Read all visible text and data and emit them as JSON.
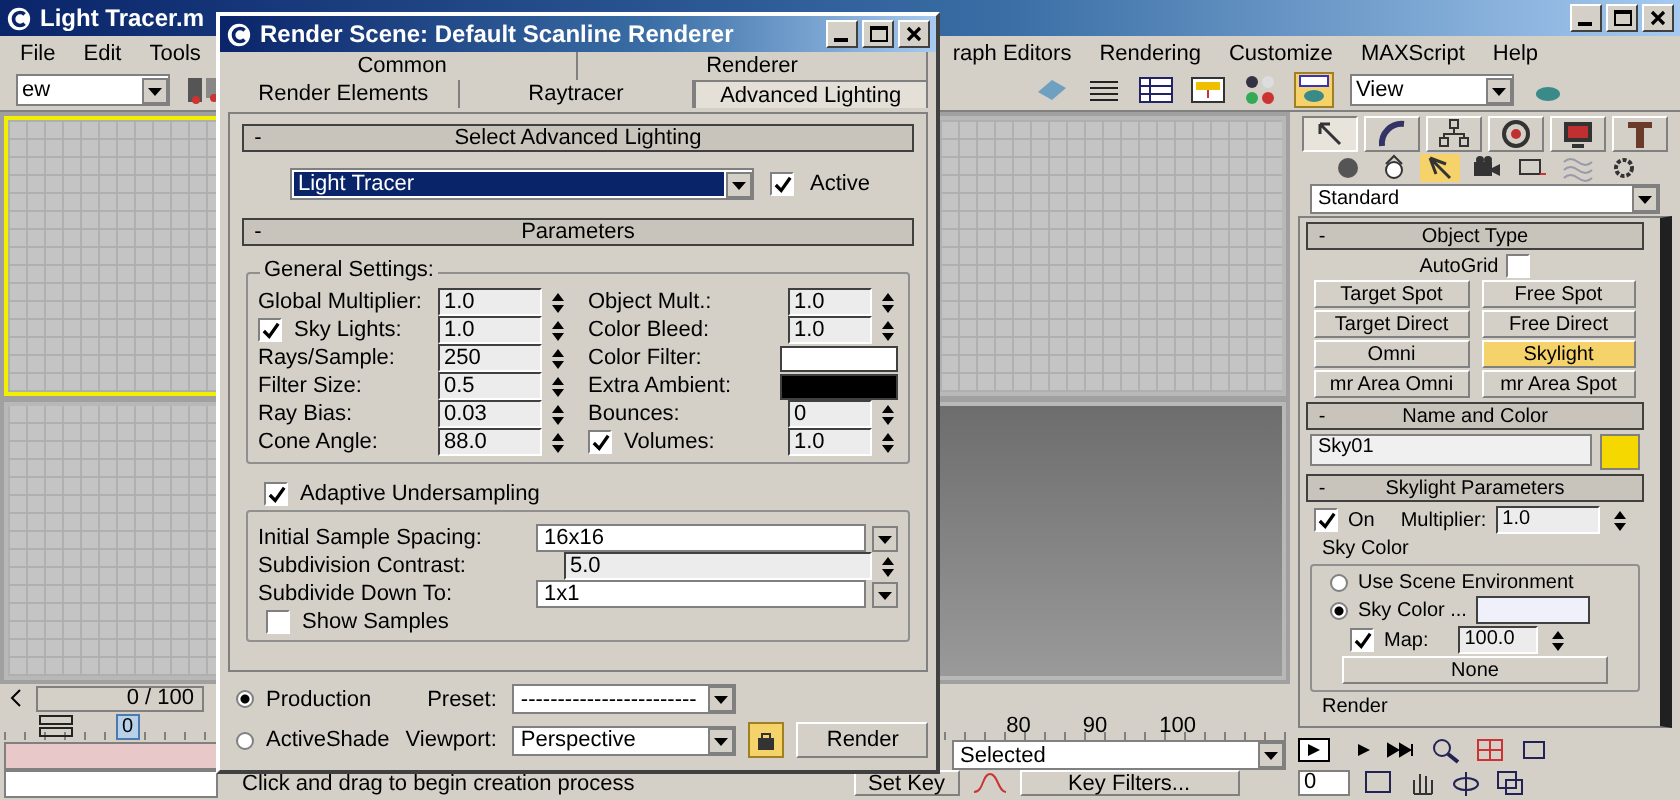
{
  "app": {
    "title": "Light Tracer.m",
    "menu": [
      "File",
      "Edit",
      "Tools",
      "raph Editors",
      "Rendering",
      "Customize",
      "MAXScript",
      "Help"
    ],
    "left_dropdown": "ew",
    "right_dropdown": "View"
  },
  "viewports": [
    {
      "active": true
    },
    {
      "active": false
    },
    {
      "active": false
    },
    {
      "active": false
    }
  ],
  "timeline": {
    "position": "0 / 100",
    "frame": "0",
    "ticks": [
      "80",
      "90",
      "100"
    ]
  },
  "status": {
    "prompt": "Click and drag to begin creation process",
    "selection": "Selected",
    "set_key": "Set Key",
    "key_filters": "Key Filters...",
    "frame_field": "0"
  },
  "command_panel": {
    "tabs": [
      {
        "selected": true
      },
      {
        "selected": false
      },
      {
        "selected": false
      },
      {
        "selected": false
      },
      {
        "selected": false
      },
      {
        "selected": false
      }
    ],
    "categories": [
      {
        "selected": false
      },
      {
        "selected": false
      },
      {
        "selected": true
      },
      {
        "selected": false
      },
      {
        "selected": false
      },
      {
        "selected": false
      },
      {
        "selected": false
      }
    ],
    "type_dropdown": "Standard",
    "object_type": {
      "sign": "-",
      "title": "Object Type",
      "autogrid": {
        "label": "AutoGrid",
        "checked": false
      },
      "buttons": [
        {
          "label": "Target Spot",
          "selected": false
        },
        {
          "label": "Free Spot",
          "selected": false
        },
        {
          "label": "Target Direct",
          "selected": false
        },
        {
          "label": "Free Direct",
          "selected": false
        },
        {
          "label": "Omni",
          "selected": false
        },
        {
          "label": "Skylight",
          "selected": true
        },
        {
          "label": "mr Area Omni",
          "selected": false
        },
        {
          "label": "mr Area Spot",
          "selected": false
        }
      ]
    },
    "name_and_color": {
      "sign": "-",
      "title": "Name and Color",
      "name": "Sky01",
      "color": "#f5d800"
    },
    "skylight": {
      "sign": "-",
      "title": "Skylight Parameters",
      "on": {
        "label": "On",
        "checked": true
      },
      "multiplier_label": "Multiplier:",
      "multiplier": "1.0",
      "sky_color": {
        "title": "Sky Color",
        "options": [
          {
            "label": "Use Scene Environment",
            "selected": false
          },
          {
            "label": "Sky Color ...",
            "selected": true
          }
        ],
        "color": "#f0f0fa",
        "map": {
          "label": "Map:",
          "checked": true,
          "value": "100.0"
        },
        "map_button": "None"
      },
      "render_group": "Render"
    }
  },
  "render_dialog": {
    "title": "Render Scene: Default Scanline Renderer",
    "tab_rows": [
      [
        {
          "label": "Common",
          "selected": false
        },
        {
          "label": "Renderer",
          "selected": false
        }
      ],
      [
        {
          "label": "Render Elements",
          "selected": false
        },
        {
          "label": "Raytracer",
          "selected": false
        },
        {
          "label": "Advanced Lighting",
          "selected": true
        }
      ]
    ],
    "select_rollout": {
      "sign": "-",
      "title": "Select Advanced Lighting",
      "plugin": "Light Tracer",
      "active": {
        "label": "Active",
        "checked": true
      }
    },
    "parameters": {
      "sign": "-",
      "title": "Parameters",
      "general_title": "General Settings:",
      "left": [
        {
          "label": "Global Multiplier:",
          "kind": "spinner",
          "value": "1.0"
        },
        {
          "label": "Sky Lights:",
          "kind": "spinner",
          "value": "1.0",
          "checked": true
        },
        {
          "label": "Rays/Sample:",
          "kind": "spinner",
          "value": "250"
        },
        {
          "label": "Filter Size:",
          "kind": "spinner",
          "value": "0.5"
        },
        {
          "label": "Ray Bias:",
          "kind": "spinner",
          "value": "0.03"
        },
        {
          "label": "Cone Angle:",
          "kind": "spinner",
          "value": "88.0"
        }
      ],
      "right": [
        {
          "label": "Object Mult.:",
          "kind": "spinner",
          "value": "1.0"
        },
        {
          "label": "Color Bleed:",
          "kind": "spinner",
          "value": "1.0"
        },
        {
          "label": "Color Filter:",
          "kind": "color",
          "color": "#ffffff"
        },
        {
          "label": "Extra Ambient:",
          "kind": "color",
          "color": "#000000"
        },
        {
          "label": "Bounces:",
          "kind": "spinner",
          "value": "0"
        },
        {
          "label": "Volumes:",
          "kind": "spinner",
          "value": "1.0",
          "checked": true
        }
      ],
      "adaptive": {
        "label": "Adaptive Undersampling",
        "checked": true,
        "rows": [
          {
            "label": "Initial Sample Spacing:",
            "kind": "dropdown",
            "value": "16x16"
          },
          {
            "label": "Subdivision Contrast:",
            "kind": "spinner",
            "value": "5.0"
          },
          {
            "label": "Subdivide Down To:",
            "kind": "dropdown",
            "value": "1x1"
          }
        ],
        "show_samples": {
          "label": "Show Samples",
          "checked": false
        }
      }
    },
    "modes": [
      {
        "label": "Production",
        "selected": true
      },
      {
        "label": "ActiveShade",
        "selected": false
      }
    ],
    "preset_label": "Preset:",
    "preset": "------------------------",
    "viewport_label": "Viewport:",
    "viewport": "Perspective",
    "locked": true,
    "render_button": "Render"
  }
}
